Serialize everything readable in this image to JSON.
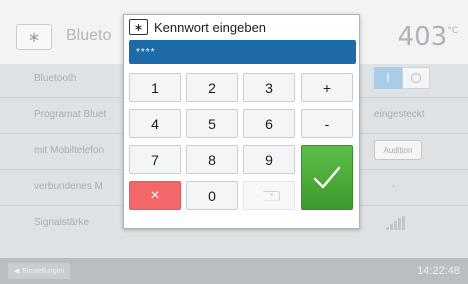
{
  "background": {
    "header_title": "Blueto",
    "bluetooth_icon": "bluetooth-icon",
    "temperature": "403",
    "temperature_unit": "°C",
    "rows": [
      {
        "label": "Bluetooth",
        "value": ""
      },
      {
        "label": "Programat Bluet",
        "value": "eingesteckt"
      },
      {
        "label": "mit Mobiltelefon",
        "value": "Audition"
      },
      {
        "label": "verbundenes M",
        "value": "-"
      },
      {
        "label": "Signalstärke",
        "value": ""
      }
    ],
    "toggle": {
      "on_label": "I",
      "off_icon": "circle-icon",
      "state": "on"
    },
    "audition_button": "Audition",
    "footer": {
      "back_label": "Einstellungen",
      "time": "14:22:48"
    }
  },
  "dialog": {
    "title": "Kennwort eingeben",
    "title_icon": "bluetooth-icon",
    "password_value": "****",
    "keys": [
      "1",
      "2",
      "3",
      "+",
      "4",
      "5",
      "6",
      "-",
      "7",
      "8",
      "9",
      "0"
    ],
    "cancel_icon": "close-icon",
    "cancel_symbol": "×",
    "backspace_icon": "backspace-icon",
    "ok_icon": "checkmark-icon",
    "ok_symbol": "✓"
  }
}
